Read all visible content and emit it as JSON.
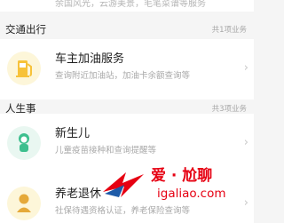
{
  "top_card": {
    "description": "余国风光，云游美景，毛笔菜谱等服务"
  },
  "sections": [
    {
      "title": "交通出行",
      "count": "共1项业务",
      "items": [
        {
          "name": "车主加油服务",
          "description": "查询附近加油站，加油卡余额查询等"
        }
      ]
    },
    {
      "title": "人生事",
      "count": "共3项业务",
      "items": [
        {
          "name": "新生儿",
          "description": "儿童疫苗接种和查询提醒等"
        },
        {
          "name": "养老退休",
          "description": "社保待遇资格认证，养老保险查询等"
        }
      ]
    }
  ],
  "watermark": {
    "brand": "爱 · 尬聊",
    "url": "igaliao.com"
  },
  "colors": {
    "watermark_red": "#e60012",
    "icon_bg": "#fdf6d9"
  }
}
